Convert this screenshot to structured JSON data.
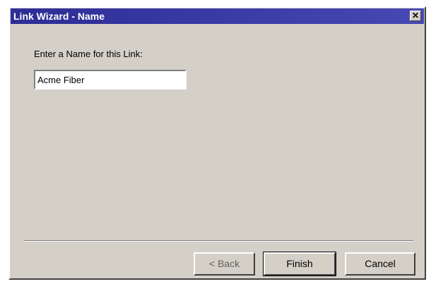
{
  "window": {
    "title": "Link Wizard - Name",
    "close_glyph": "✕"
  },
  "form": {
    "prompt": "Enter a Name for this Link:",
    "name_value": "Acme Fiber"
  },
  "buttons": {
    "back": "< Back",
    "finish": "Finish",
    "cancel": "Cancel"
  },
  "colors": {
    "titlebar": "#3a3aa0",
    "face": "#d4d0c8"
  }
}
